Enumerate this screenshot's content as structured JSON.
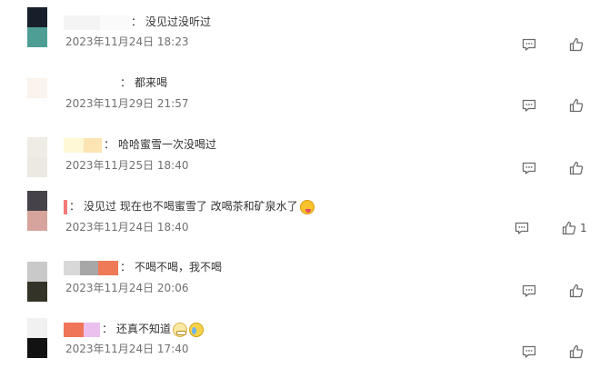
{
  "comments": [
    {
      "text": "没见过没听过",
      "time": "2023年11月24日 18:23",
      "avatar_colors": [
        "#17202a",
        "#4f9e95"
      ],
      "name_colors": [
        "#f4f4f4",
        "#fafafa"
      ],
      "likes": ""
    },
    {
      "text": "都来喝",
      "time": "2023年11月29日 21:57",
      "avatar_colors": [
        "#faf3ee",
        "#ffffff"
      ],
      "name_colors": [
        "#ffffff"
      ],
      "likes": ""
    },
    {
      "text": "哈哈蜜雪一次没喝过",
      "time": "2023年11月25日 18:40",
      "avatar_colors": [
        "#efece6",
        "#ece8e2"
      ],
      "name_colors": [
        "#fef8d6",
        "#fde4b3"
      ],
      "likes": ""
    },
    {
      "text": "没见过 现在也不喝蜜雪了 改喝茶和矿泉水了",
      "time": "2023年11月24日 18:40",
      "avatar_colors": [
        "#454349",
        "#d6a49c"
      ],
      "name_colors": [
        "#f47a7a"
      ],
      "emojis": [
        "yummy-emoji"
      ],
      "likes": "1"
    },
    {
      "text": "不喝不喝，我不喝",
      "time": "2023年11月24日 20:06",
      "avatar_colors": [
        "#c9c9c9",
        "#343327"
      ],
      "name_colors": [
        "#d8d8d8",
        "#a7a7a7",
        "#ef7a57"
      ],
      "likes": ""
    },
    {
      "text": "还真不知道",
      "time": "2023年11月24日 17:40",
      "avatar_colors": [
        "#f1f1f1",
        "#121212"
      ],
      "name_colors": [
        "#f07458",
        "#ebc0ef"
      ],
      "emojis": [
        "grin-emoji",
        "sad-emoji"
      ],
      "likes": ""
    }
  ],
  "icons": {
    "reply": "comment-icon",
    "like": "thumbs-up-icon"
  },
  "colors": {
    "text": "#333333",
    "time": "#707070",
    "icon": "#6b6b6b",
    "background": "#ffffff"
  }
}
